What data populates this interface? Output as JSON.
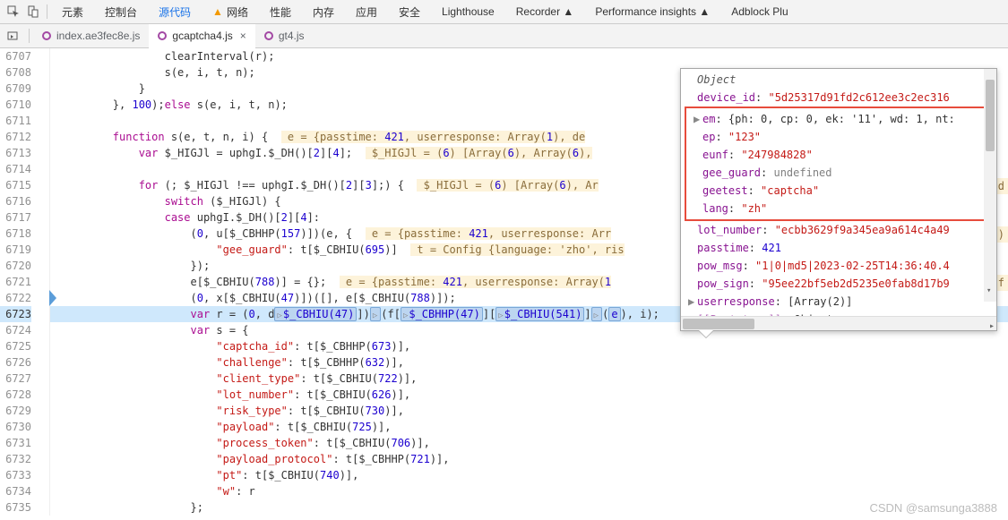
{
  "toolbar": {
    "tabs": [
      "元素",
      "控制台",
      "源代码",
      "网络",
      "性能",
      "内存",
      "应用",
      "安全",
      "Lighthouse",
      "Recorder ▲",
      "Performance insights ▲",
      "Adblock Plu"
    ]
  },
  "file_tabs": {
    "items": [
      {
        "label": "index.ae3fec8e.js",
        "active": false
      },
      {
        "label": "gcaptcha4.js",
        "active": true
      },
      {
        "label": "gt4.js",
        "active": false
      }
    ]
  },
  "gutter_start": 6707,
  "gutter_end": 6735,
  "highlight_line": 6723,
  "code_lines": [
    "                clearInterval(r);",
    "                s(e, i, t, n);",
    "            }",
    "        }, 100);else s(e, i, t, n);",
    "",
    "        function s(e, t, n, i) {  |HINT|e = {passtime: 421, userresponse: Array(1), de|",
    "            var $_HIGJl = uphgI.$_DH()[2][4];  |HINT|$_HIGJl = (6) [Array(6), Array(6),|",
    "",
    "            for (; $_HIGJl !== uphgI.$_DH()[2][3];) {  |HINT|$_HIGJl = (6) [Array(6), Ar|",
    "                switch ($_HIGJl) {",
    "                case uphgI.$_DH()[2][4]:",
    "                    (0, u[$_CBHHP(157)])(e, {  |HINT|e = {passtime: 421, userresponse: Arr|",
    "                        \"gee_guard\": t[$_CBHIU(695)]  |HINT|t = Config {language: 'zho', ris|",
    "                    });",
    "                    e[$_CBHIU(788)] = {};  |HINT|e = {passtime: 421, userresponse: Array(1|",
    "                    (0, x[$_CBHIU(47)])([], e[$_CBHIU(788)]);",
    "                    var r = (0, d|TOK|▷$_CBHIU(47)|])|TOK|▷|(f[|TOK|▷$_CBHHP(47)|][|TOK|▷$_CBHIU(541)|]|TOK|▷|(|TOK|e|), i);",
    "                    var s = {",
    "                        \"captcha_id\": t[$_CBHHP(673)],",
    "                        \"challenge\": t[$_CBHHP(632)],",
    "                        \"client_type\": t[$_CBHIU(722)],",
    "                        \"lot_number\": t[$_CBHIU(626)],",
    "                        \"risk_type\": t[$_CBHIU(730)],",
    "                        \"payload\": t[$_CBHIU(725)],",
    "                        \"process_token\": t[$_CBHIU(706)],",
    "                        \"payload_protocol\": t[$_CBHHP(721)],",
    "                        \"pt\": t[$_CBHIU(740)],",
    "                        \"w\": r",
    "                    };"
  ],
  "popup": {
    "header": "Object",
    "rows_top": [
      {
        "k": "device_id",
        "v": "\"5d25317d91fd2c612ee3c2ec316",
        "t": "str"
      }
    ],
    "rows_boxed": [
      {
        "k": "em",
        "v": "{ph: 0, cp: 0, ek: '11', wd: 1, nt:",
        "t": "obj",
        "tri": "▶"
      },
      {
        "k": "ep",
        "v": "\"123\"",
        "t": "str"
      },
      {
        "k": "eunf",
        "v": "\"247984828\"",
        "t": "str"
      },
      {
        "k": "gee_guard",
        "v": "undefined",
        "t": "und"
      },
      {
        "k": "geetest",
        "v": "\"captcha\"",
        "t": "str"
      },
      {
        "k": "lang",
        "v": "\"zh\"",
        "t": "str"
      }
    ],
    "rows_bottom": [
      {
        "k": "lot_number",
        "v": "\"ecbb3629f9a345ea9a614c4a49",
        "t": "str"
      },
      {
        "k": "passtime",
        "v": "421",
        "t": "num"
      },
      {
        "k": "pow_msg",
        "v": "\"1|0|md5|2023-02-25T14:36:40.4",
        "t": "str"
      },
      {
        "k": "pow_sign",
        "v": "\"95ee22bf5eb2d5235e0fab8d17b9",
        "t": "str"
      },
      {
        "k": "userresponse",
        "v": "[Array(2)]",
        "t": "obj",
        "tri": "▶"
      },
      {
        "k": "[[Prototype]]",
        "v": "Object",
        "t": "obj",
        "tri": "▶",
        "faded": true
      }
    ]
  },
  "side_hints": [
    "ld",
    "])",
    "bf"
  ],
  "watermark": "CSDN @samsunga3888"
}
